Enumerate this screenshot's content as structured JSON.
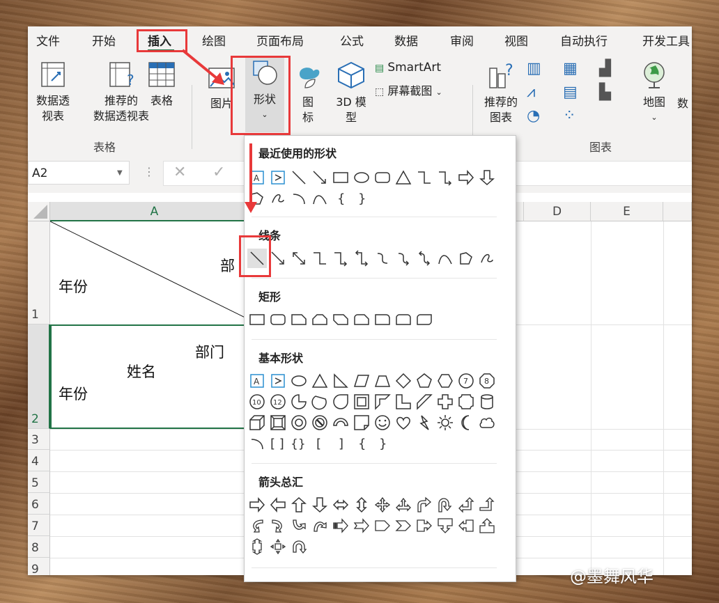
{
  "menu": {
    "tabs": [
      "文件",
      "开始",
      "插入",
      "绘图",
      "页面布局",
      "公式",
      "数据",
      "审阅",
      "视图",
      "自动执行",
      "开发工具"
    ],
    "active_tab": "插入"
  },
  "ribbon": {
    "pivot_table": "数据透\n视表",
    "recommended_pivot": "推荐的\n数据透视表",
    "table": "表格",
    "group_tables": "表格",
    "pictures": "图片",
    "shapes": "形状",
    "icons": "图\n标",
    "model3d": "3D 模\n型",
    "smartart": "SmartArt",
    "screenshot": "屏幕截图",
    "recommended_charts": "推荐的\n图表",
    "map": "地图",
    "data_cut": "数",
    "group_charts": "图表"
  },
  "formula_bar": {
    "name_box": "A2"
  },
  "grid": {
    "columns": [
      "A",
      "D",
      "E"
    ],
    "rows": [
      "1",
      "2",
      "3",
      "4",
      "5",
      "6",
      "7",
      "8",
      "9"
    ],
    "a1_top_right": "部",
    "a1_bottom_left": "年份",
    "a2_top_right": "部门",
    "a2_middle": "姓名",
    "a2_bottom_left": "年份"
  },
  "shapes_menu": {
    "recent": "最近使用的形状",
    "lines": "线条",
    "rectangles": "矩形",
    "basic": "基本形状",
    "arrows": "箭头总汇"
  },
  "colors": {
    "accent": "#217346",
    "highlight": "#e8393a",
    "shape_stroke": "#3a3a3a"
  },
  "watermark": "@墨舞风华"
}
